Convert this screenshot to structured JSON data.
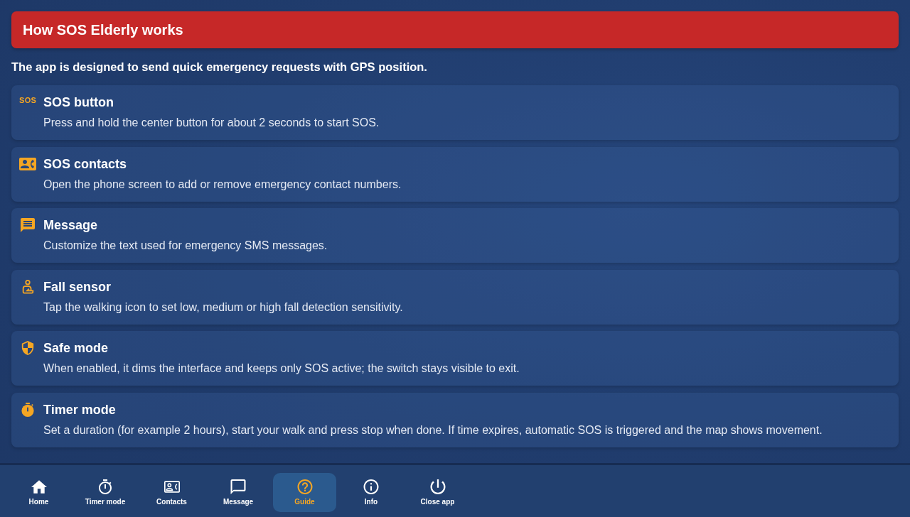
{
  "header": {
    "title": "How SOS Elderly works"
  },
  "intro": "The app is designed to send quick emergency requests with GPS position.",
  "features": [
    {
      "kind": "sos",
      "icon_text": "SOS",
      "title": "SOS button",
      "description": "Press and hold the center button for about 2 seconds to start SOS."
    },
    {
      "kind": "contacts",
      "title": "SOS contacts",
      "description": "Open the phone screen to add or remove emergency contact numbers."
    },
    {
      "kind": "message",
      "title": "Message",
      "description": "Customize the text used for emergency SMS messages."
    },
    {
      "kind": "person",
      "title": "Fall sensor",
      "description": "Tap the walking icon to set low, medium or high fall detection sensitivity."
    },
    {
      "kind": "shield",
      "title": "Safe mode",
      "description": "When enabled, it dims the interface and keeps only SOS active; the switch stays visible to exit."
    },
    {
      "kind": "timer",
      "title": "Timer mode",
      "description": "Set a duration (for example 2 hours), start your walk and press stop when done. If time expires, automatic SOS is triggered and the map shows movement."
    }
  ],
  "nav": [
    {
      "kind": "home",
      "label": "Home",
      "selected": false
    },
    {
      "kind": "timer",
      "label": "Timer mode",
      "selected": false
    },
    {
      "kind": "contacts",
      "label": "Contacts",
      "selected": false
    },
    {
      "kind": "message",
      "label": "Message",
      "selected": false
    },
    {
      "kind": "help",
      "label": "Guide",
      "selected": true
    },
    {
      "kind": "info",
      "label": "Info",
      "selected": false
    },
    {
      "kind": "power",
      "label": "Close app",
      "selected": false
    }
  ]
}
